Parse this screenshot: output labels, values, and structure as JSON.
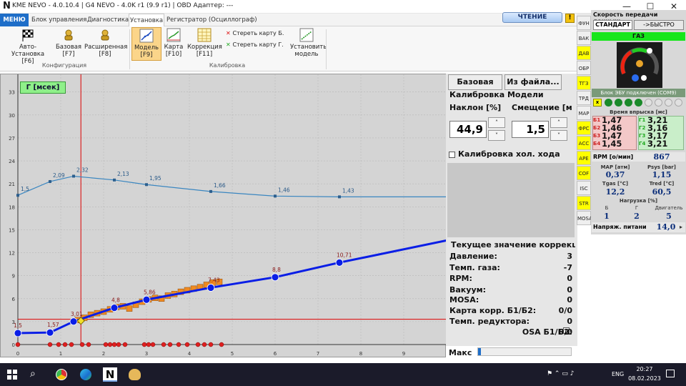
{
  "window": {
    "title": "KME NEVO - 4.0.10.4  |  G4 NEVO - 4.0K r1 (9.9 r1)  |  OBD Адаптер: ---",
    "min": "—",
    "max": "☐",
    "close": "✕"
  },
  "tabs": [
    "МЕНЮ",
    "Блок управления",
    "Диагностика",
    "Установка",
    "Регистратор (Осциллограф)"
  ],
  "read_button": "ЧТЕНИЕ",
  "ribbon": {
    "config": [
      {
        "label": "Авто-Установка",
        "key": "[F6]"
      },
      {
        "label": "Базовая",
        "key": "[F7]"
      },
      {
        "label": "Расширенная",
        "key": "[F8]"
      }
    ],
    "config_group": "Конфигурация",
    "calib": [
      {
        "label": "Модель",
        "key": "[F9]"
      },
      {
        "label": "Карта",
        "key": "[F10]"
      },
      {
        "label": "Коррекция",
        "key": "[F11]"
      }
    ],
    "erase_b": "Стереть карту Б.",
    "erase_g": "Стереть карту Г.",
    "install_model": [
      "Установить",
      "модель"
    ],
    "calib_group": "Калибровка"
  },
  "chart_data": {
    "type": "line",
    "legend": "Г [мсек]",
    "xlim": [
      0,
      10
    ],
    "ylim": [
      0,
      34
    ],
    "x_ticks": [
      0,
      1,
      2,
      3,
      4,
      5,
      6,
      7,
      8,
      9
    ],
    "y_ticks": [
      0,
      3,
      6,
      9,
      12,
      15,
      18,
      21,
      24,
      27,
      30,
      33
    ],
    "cursor_x": 1.47,
    "cursor_y": 3.3,
    "series": [
      {
        "values_x": [
          0,
          0.75,
          1.3,
          2.25,
          3.0,
          4.5,
          6.0,
          7.5
        ],
        "values_y": [
          1.5,
          1.57,
          3.01,
          4.8,
          5.86,
          7.43,
          8.8,
          10.71
        ],
        "labels": [
          "1,5",
          "1,57",
          "3,01",
          "4,8",
          "5,86",
          "7,43",
          "8,8",
          "10,71"
        ]
      },
      {
        "values_x": [
          0,
          0.75,
          1.3,
          2.25,
          3.0,
          4.5,
          6.0,
          7.5
        ],
        "values_y": [
          19.5,
          21.3,
          22.0,
          21.5,
          20.9,
          20.0,
          19.4,
          19.3
        ],
        "labels": [
          "1,5",
          "2,09",
          "2,32",
          "2,13",
          "1,95",
          "1,66",
          "1,46",
          "1,43"
        ]
      }
    ],
    "samples_x": [
      1.4,
      1.55,
      1.7,
      1.85,
      2.0,
      2.15,
      2.3,
      2.45,
      2.6,
      2.75,
      2.9,
      3.05,
      3.2,
      3.35,
      3.5,
      3.65,
      3.8,
      3.95,
      4.1,
      4.25,
      4.4,
      4.55,
      4.7
    ],
    "samples_y": [
      3.2,
      3.5,
      3.9,
      4.1,
      4.3,
      4.6,
      4.9,
      5.0,
      4.7,
      5.2,
      5.6,
      5.9,
      6.1,
      6.0,
      6.4,
      6.6,
      6.9,
      7.1,
      7.3,
      7.5,
      7.8,
      8.1,
      8.2
    ],
    "zero_points_x": [
      0,
      0.75,
      0.95,
      1.1,
      1.25,
      1.5,
      1.65,
      2.05,
      2.15,
      2.25,
      2.35,
      2.5,
      2.95,
      3.05,
      3.15,
      3.4,
      3.55,
      3.75,
      3.95,
      4.2,
      4.35,
      4.5,
      4.75
    ]
  },
  "right": {
    "base": "Базовая",
    "from_file": "Из файла...",
    "title": "Калибровка Модели",
    "slope_label": "Наклон [%]",
    "offset_label": "Смещение [м",
    "slope": "44,9",
    "offset": "1,5",
    "idle": "Калибровка хол. хода",
    "current_title": "Текущее значение коррекци",
    "rows": [
      [
        "Давление:",
        "3"
      ],
      [
        "Темп. газа:",
        "-7"
      ],
      [
        "RPM:",
        "0"
      ],
      [
        "Вакуум:",
        "0"
      ],
      [
        "MOSA:",
        "0"
      ],
      [
        "Карта корр. Б1/Б2:",
        "0/0"
      ],
      [
        "Темп. редуктора:",
        "0"
      ],
      [
        "OSA Б1/Б2:",
        "0/0"
      ]
    ],
    "max": "Макс"
  },
  "sidebar": [
    "ФУН",
    "ВАК",
    "ДАВ",
    "ОБР",
    "ТГЗ",
    "ТРД",
    "МАР",
    "ФРС",
    "АСС",
    "АРЕ",
    "COF",
    "ISC",
    "STR",
    "MOSA"
  ],
  "panel": {
    "speed_title": "Скорость передачи данных:",
    "std": "СТАНДАРТ",
    "fast": "->БЫСТРО",
    "gas": "ГАЗ",
    "ecu": "Блок ЭБУ подключен (COM9)",
    "inj_title": "Время впрыска [мс]",
    "b": [
      [
        "Б1",
        "1,47"
      ],
      [
        "Б2",
        "1,46"
      ],
      [
        "Б3",
        "1,47"
      ],
      [
        "Б4",
        "1,45"
      ]
    ],
    "g": [
      [
        "Г1",
        "3,21"
      ],
      [
        "Г2",
        "3,16"
      ],
      [
        "Г3",
        "3,17"
      ],
      [
        "Г4",
        "3,21"
      ]
    ],
    "rpm_label": "RPM [о/мин]",
    "rpm": "867",
    "map_label": "МАР [атм]",
    "map": "0,37",
    "psys_label": "Psys [bar]",
    "psys": "1,15",
    "tgas_label": "Tgas [°C]",
    "tgas": "12,2",
    "tred_label": "Tred [°C]",
    "tred": "60,5",
    "load_title": "Нагрузка [%]",
    "lb": "Б",
    "lg": "Г",
    "le": "Двигатель",
    "vb": "1",
    "vg": "2",
    "ve": "5",
    "volt_label": "Напряж. питани",
    "volt": "14,0"
  },
  "taskbar": {
    "lang": "ENG",
    "time": "20:27",
    "date": "08.02.2023"
  }
}
